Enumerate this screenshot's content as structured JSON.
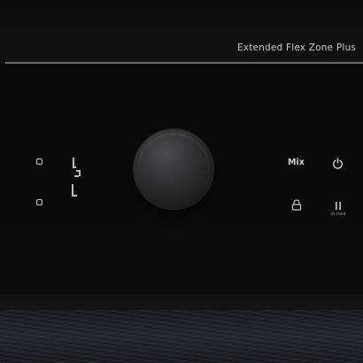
{
  "header": {
    "brand_text": "Extended Flex Zone Plus"
  },
  "controls": {
    "mix_label": "Mix",
    "hold_label": "3s Hold"
  },
  "icons": {
    "power": "power-icon",
    "lock": "lock-icon",
    "pause": "pause-icon",
    "up_arrow": "temp-up-icon",
    "down_arrow": "temp-down-icon"
  },
  "colors": {
    "background": "#0b0b0c",
    "text": "#c9c9c9",
    "divider": "#7a7a7a",
    "dial": "#2c2d30"
  }
}
